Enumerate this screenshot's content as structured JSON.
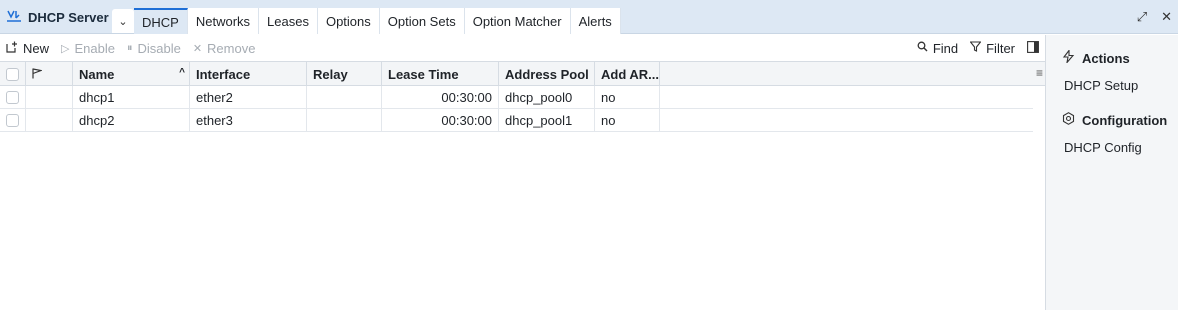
{
  "app": {
    "title": "DHCP Server"
  },
  "tabs": [
    {
      "label": "DHCP",
      "active": true
    },
    {
      "label": "Networks"
    },
    {
      "label": "Leases"
    },
    {
      "label": "Options"
    },
    {
      "label": "Option Sets"
    },
    {
      "label": "Option Matcher"
    },
    {
      "label": "Alerts"
    }
  ],
  "toolbar": {
    "new_label": "New",
    "enable_label": "Enable",
    "disable_label": "Disable",
    "remove_label": "Remove",
    "find_label": "Find",
    "filter_label": "Filter"
  },
  "table": {
    "columns": [
      "Name",
      "Interface",
      "Relay",
      "Lease Time",
      "Address Pool",
      "Add AR..."
    ],
    "rows": [
      {
        "name": "dhcp1",
        "interface": "ether2",
        "relay": "",
        "lease_time": "00:30:00",
        "address_pool": "dhcp_pool0",
        "add_arp": "no"
      },
      {
        "name": "dhcp2",
        "interface": "ether3",
        "relay": "",
        "lease_time": "00:30:00",
        "address_pool": "dhcp_pool1",
        "add_arp": "no"
      }
    ]
  },
  "side": {
    "actions_title": "Actions",
    "actions_link": "DHCP Setup",
    "config_title": "Configuration",
    "config_link": "DHCP Config"
  },
  "colors": {
    "accent": "#1f6fd6",
    "titlebar_bg": "#dde8f4"
  }
}
